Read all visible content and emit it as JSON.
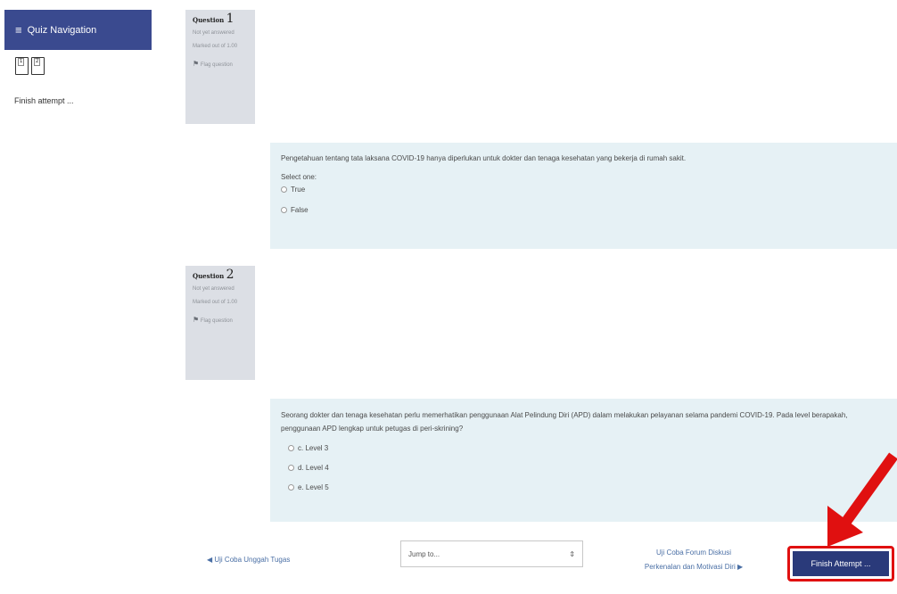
{
  "sidebar": {
    "header_label": "Quiz Navigation",
    "hamburger": "menu-icon",
    "buttons": [
      "1",
      "2"
    ],
    "finish_link": "Finish attempt ..."
  },
  "questions": [
    {
      "label": "Question",
      "number": "1",
      "status": "Not yet answered",
      "marked": "Marked out of 1.00",
      "flag": "Flag question",
      "text": "Pengetahuan tentang tata laksana COVID-19 hanya diperlukan untuk dokter dan tenaga kesehatan yang bekerja di rumah sakit.",
      "prompt": "Select one:",
      "options": [
        "True",
        "False"
      ]
    },
    {
      "label": "Question",
      "number": "2",
      "status": "Not yet answered",
      "marked": "Marked out of 1.00",
      "flag": "Flag question",
      "text": "Seorang dokter dan tenaga kesehatan perlu memerhatikan penggunaan Alat Pelindung Diri (APD) dalam melakukan pelayanan selama pandemi COVID-19. Pada level berapakah, penggunaan APD lengkap untuk petugas di peri-skrining?",
      "options": [
        "c. Level 3",
        "d. Level 4",
        "e. Level 5"
      ]
    }
  ],
  "footer": {
    "prev_link": "◀ Uji Coba Unggah Tugas",
    "jump_placeholder": "Jump to...",
    "next_link_line1": "Uji Coba Forum Diskusi",
    "next_link_line2": "Perkenalan dan Motivasi Diri ▶",
    "finish_button": "Finish Attempt ..."
  },
  "colors": {
    "header_bg": "#3a4a8f",
    "content_bg": "#e6f1f5",
    "info_bg": "#dcdfe5",
    "annotation": "#e01010"
  }
}
